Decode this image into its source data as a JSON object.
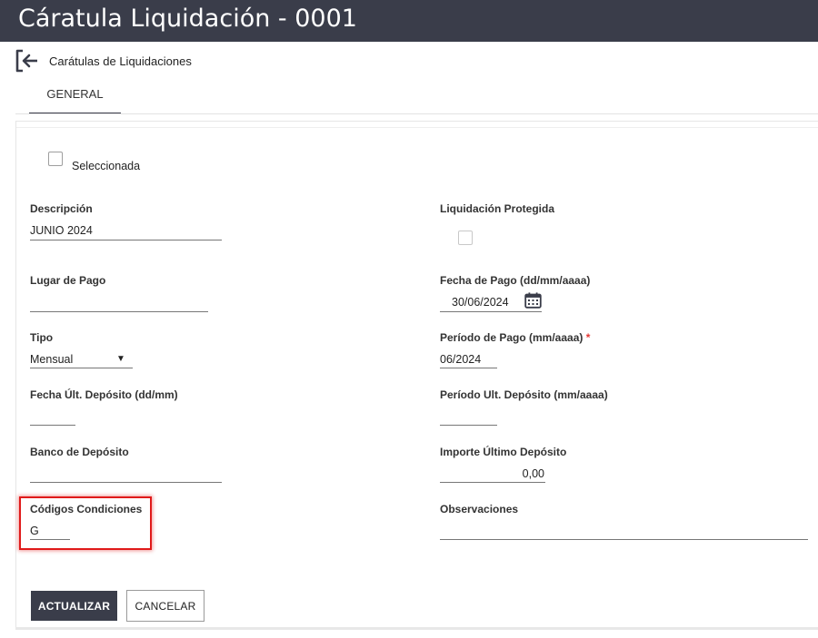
{
  "window": {
    "title": "Cáratula Liquidación - 0001"
  },
  "nav": {
    "back_label": "Carátulas de Liquidaciones"
  },
  "tabs": [
    {
      "label": "GENERAL",
      "active": true
    }
  ],
  "form": {
    "selected": {
      "label": "Seleccionada",
      "checked": false
    },
    "descripcion": {
      "label": "Descripción",
      "value": "JUNIO 2024"
    },
    "liquidacion_protegida": {
      "label": "Liquidación Protegida",
      "checked": false
    },
    "lugar_pago": {
      "label": "Lugar de Pago",
      "value": ""
    },
    "fecha_pago": {
      "label": "Fecha de Pago (dd/mm/aaaa)",
      "value": "30/06/2024"
    },
    "tipo": {
      "label": "Tipo",
      "value": "Mensual"
    },
    "periodo_pago": {
      "label": "Período de Pago (mm/aaaa)",
      "required_mark": "*",
      "value": "06/2024"
    },
    "fecha_ult_deposito": {
      "label": "Fecha Últ. Depósito (dd/mm)",
      "value": ""
    },
    "periodo_ult_deposito": {
      "label": "Período Ult. Depósito (mm/aaaa)",
      "value": ""
    },
    "banco_deposito": {
      "label": "Banco de Depósito",
      "value": ""
    },
    "importe_ultimo_deposito": {
      "label": "Importe Último Depósito",
      "value": "0,00"
    },
    "codigos_condiciones": {
      "label": "Códigos Condiciones",
      "value": "G",
      "highlighted": true
    },
    "observaciones": {
      "label": "Observaciones",
      "value": ""
    }
  },
  "actions": {
    "update_label": "ACTUALIZAR",
    "cancel_label": "CANCELAR"
  },
  "colors": {
    "header_bg": "#3a3d4a",
    "highlight_border": "#e01a1a",
    "required": "#e53935"
  },
  "icons": {
    "back": "arrow-exit-icon",
    "calendar": "calendar-icon",
    "dropdown": "dropdown-arrow-icon"
  }
}
